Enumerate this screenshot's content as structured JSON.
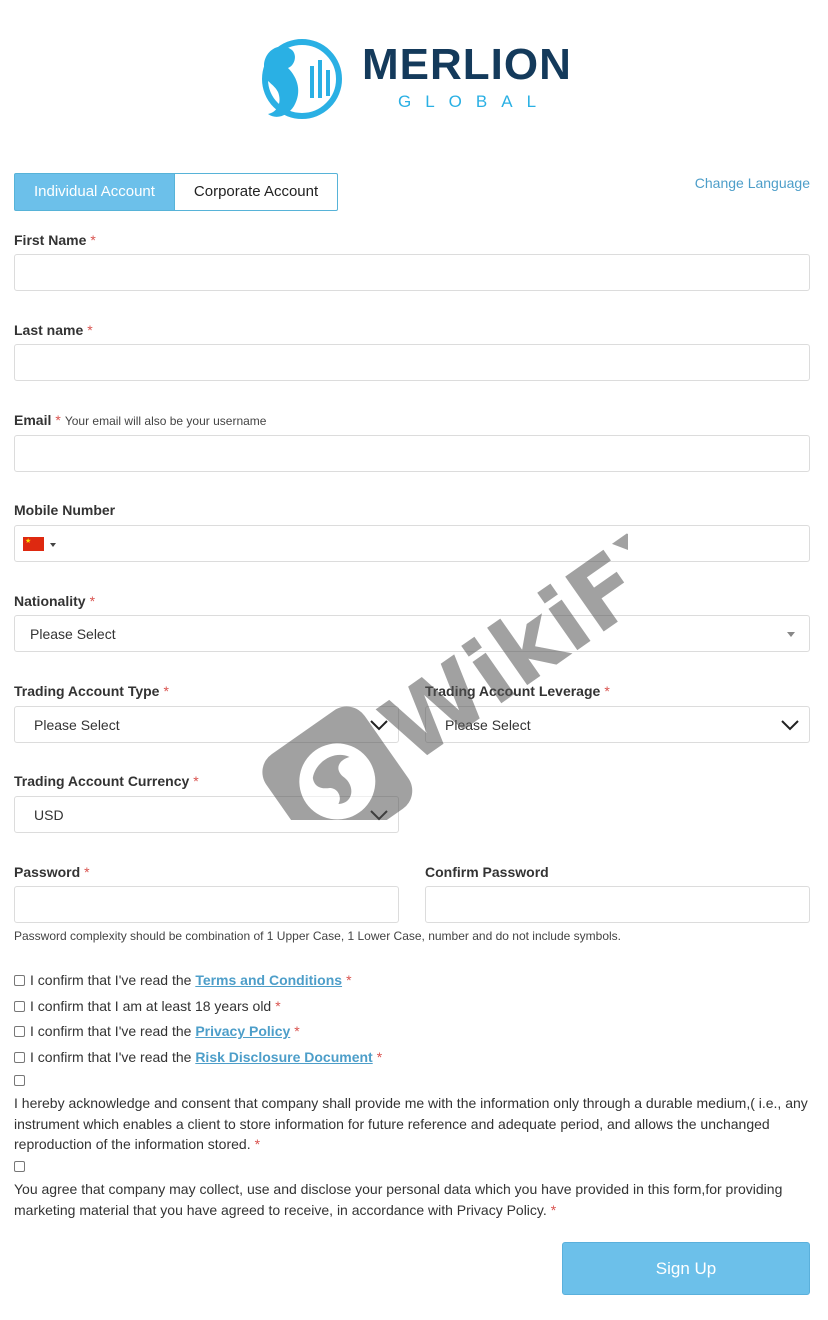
{
  "logo": {
    "name": "MERLION",
    "subtitle": "GLOBAL"
  },
  "tabs": [
    {
      "label": "Individual Account",
      "active": true
    },
    {
      "label": "Corporate Account",
      "active": false
    }
  ],
  "change_language": "Change Language",
  "required_mark": "*",
  "form": {
    "first_name": {
      "label": "First Name",
      "value": ""
    },
    "last_name": {
      "label": "Last name",
      "value": ""
    },
    "email": {
      "label": "Email",
      "hint": "Your email will also be your username",
      "value": ""
    },
    "mobile": {
      "label": "Mobile Number",
      "flag": "china-flag-icon",
      "value": ""
    },
    "nationality": {
      "label": "Nationality",
      "selected": "Please Select"
    },
    "account_type": {
      "label": "Trading Account Type",
      "selected": "Please Select"
    },
    "leverage": {
      "label": "Trading Account Leverage",
      "selected": "Please Select"
    },
    "currency": {
      "label": "Trading Account Currency",
      "selected": "USD"
    },
    "password": {
      "label": "Password",
      "value": ""
    },
    "confirm_password": {
      "label": "Confirm Password",
      "value": ""
    },
    "password_note": "Password complexity should be combination of 1 Upper Case, 1 Lower Case, number and do not include symbols."
  },
  "consents": {
    "terms": {
      "prefix": "I confirm that I've read the",
      "link": "Terms and Conditions"
    },
    "age": {
      "text": "I confirm that I am at least 18 years old"
    },
    "privacy": {
      "prefix": "I confirm that I've read the",
      "link": "Privacy Policy"
    },
    "risk": {
      "prefix": "I confirm that I've read the",
      "link": "Risk Disclosure Document"
    },
    "durable_medium": "I hereby acknowledge and consent that company shall provide me with the information only through a durable medium,( i.e., any instrument which enables a client to store information for future reference and adequate period, and allows the unchanged reproduction of the information stored.",
    "marketing": "You agree that company may collect, use and disclose your personal data which you have provided in this form,for providing marketing material that you have agreed to receive, in accordance with Privacy Policy."
  },
  "signup_label": "Sign Up",
  "watermark": "WikiFX",
  "colors": {
    "accent": "#6cc0ea",
    "link": "#4d9ec9",
    "required": "#d9534f",
    "brand_dark": "#143a5b",
    "brand_light": "#2ab0e4"
  }
}
